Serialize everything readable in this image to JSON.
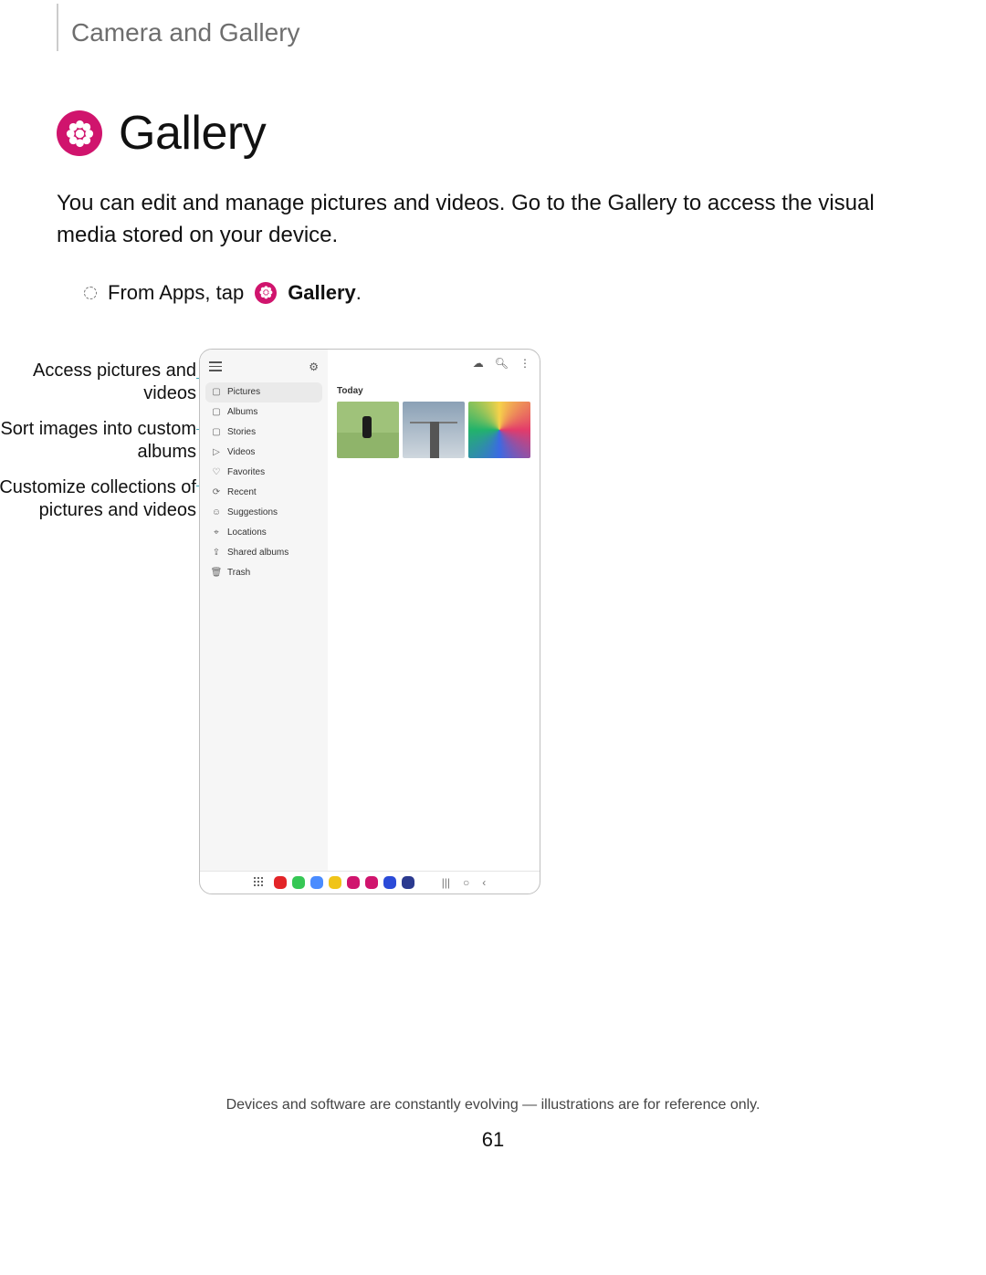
{
  "breadcrumb": "Camera and Gallery",
  "title": "Gallery",
  "intro": "You can edit and manage pictures and videos. Go to the Gallery to access the visual media stored on your device.",
  "step": {
    "prefix": "From Apps, tap ",
    "app": "Gallery",
    "suffix": "."
  },
  "callouts": {
    "c1": "Access pictures and videos",
    "c2": "Sort images into custom albums",
    "c3": "Customize collections of pictures and videos"
  },
  "sidebar_top": {
    "settings_label": "Settings"
  },
  "sidebar": [
    {
      "icon": "▢",
      "label": "Pictures"
    },
    {
      "icon": "▢",
      "label": "Albums"
    },
    {
      "icon": "▢",
      "label": "Stories"
    },
    {
      "icon": "▷",
      "label": "Videos"
    },
    {
      "icon": "♡",
      "label": "Favorites"
    },
    {
      "icon": "⟳",
      "label": "Recent"
    },
    {
      "icon": "☺",
      "label": "Suggestions"
    },
    {
      "icon": "⌖",
      "label": "Locations"
    },
    {
      "icon": "⇪",
      "label": "Shared albums"
    },
    {
      "icon": "🗑",
      "label": "Trash"
    }
  ],
  "main": {
    "today": "Today"
  },
  "taskbar_colors": [
    "#e32428",
    "#36c755",
    "#4a8cff",
    "#f0c419",
    "#d0146d",
    "#d0146d",
    "#2b4bd8",
    "#2b3a8f"
  ],
  "footnote": "Devices and software are constantly evolving — illustrations are for reference only.",
  "page_number": "61"
}
